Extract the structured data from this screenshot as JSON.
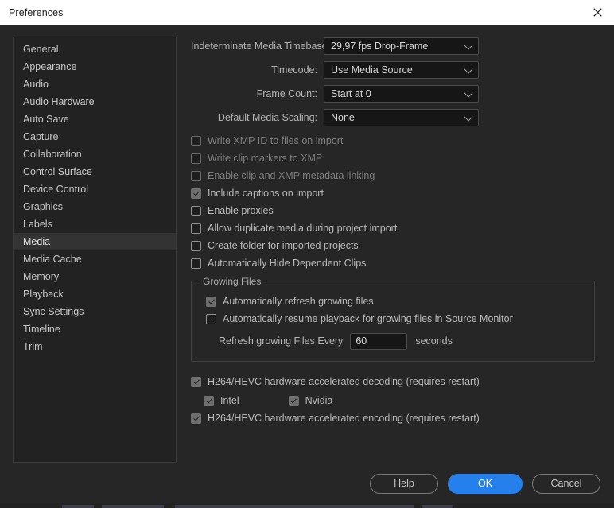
{
  "window": {
    "title": "Preferences",
    "close_icon": "close-icon"
  },
  "sidebar": {
    "items": [
      {
        "label": "General",
        "selected": false
      },
      {
        "label": "Appearance",
        "selected": false
      },
      {
        "label": "Audio",
        "selected": false
      },
      {
        "label": "Audio Hardware",
        "selected": false
      },
      {
        "label": "Auto Save",
        "selected": false
      },
      {
        "label": "Capture",
        "selected": false
      },
      {
        "label": "Collaboration",
        "selected": false
      },
      {
        "label": "Control Surface",
        "selected": false
      },
      {
        "label": "Device Control",
        "selected": false
      },
      {
        "label": "Graphics",
        "selected": false
      },
      {
        "label": "Labels",
        "selected": false
      },
      {
        "label": "Media",
        "selected": true
      },
      {
        "label": "Media Cache",
        "selected": false
      },
      {
        "label": "Memory",
        "selected": false
      },
      {
        "label": "Playback",
        "selected": false
      },
      {
        "label": "Sync Settings",
        "selected": false
      },
      {
        "label": "Timeline",
        "selected": false
      },
      {
        "label": "Trim",
        "selected": false
      }
    ]
  },
  "main": {
    "dropdowns": [
      {
        "label": "Indeterminate Media Timebase:",
        "value": "29,97 fps Drop-Frame",
        "chevron": "chevron-down-icon"
      },
      {
        "label": "Timecode:",
        "value": "Use Media Source",
        "chevron": "chevron-down-icon"
      },
      {
        "label": "Frame Count:",
        "value": "Start at 0",
        "chevron": "chevron-down-icon"
      },
      {
        "label": "Default Media Scaling:",
        "value": "None",
        "chevron": "chevron-down-icon"
      }
    ],
    "checkboxes": [
      {
        "label": "Write XMP ID to files on import",
        "checked": false,
        "disabled": true
      },
      {
        "label": "Write clip markers to XMP",
        "checked": false,
        "disabled": true
      },
      {
        "label": "Enable clip and XMP metadata linking",
        "checked": false,
        "disabled": true
      },
      {
        "label": "Include captions on import",
        "checked": true,
        "disabled": false
      },
      {
        "label": "Enable proxies",
        "checked": false,
        "disabled": false
      },
      {
        "label": "Allow duplicate media during project import",
        "checked": false,
        "disabled": false
      },
      {
        "label": "Create folder for imported projects",
        "checked": false,
        "disabled": false
      },
      {
        "label": "Automatically Hide Dependent Clips",
        "checked": false,
        "disabled": false
      }
    ],
    "growing_files": {
      "legend": "Growing Files",
      "auto_refresh": {
        "label": "Automatically refresh growing files",
        "checked": true
      },
      "auto_resume": {
        "label": "Automatically resume playback for growing files in Source Monitor",
        "checked": false
      },
      "refresh_label": "Refresh growing Files Every",
      "refresh_value": "60",
      "unit_label": "seconds"
    },
    "hardware": {
      "decoding": {
        "label": "H264/HEVC hardware accelerated decoding (requires restart)",
        "checked": true
      },
      "intel": {
        "label": "Intel",
        "checked": true
      },
      "nvidia": {
        "label": "Nvidia",
        "checked": true
      },
      "encoding": {
        "label": "H264/HEVC hardware accelerated encoding (requires restart)",
        "checked": true
      }
    }
  },
  "footer": {
    "help_label": "Help",
    "ok_label": "OK",
    "cancel_label": "Cancel"
  },
  "colors": {
    "accent": "#2680eb",
    "titlebar_bg": "#ffffff",
    "dialog_bg": "#262626",
    "sidebar_bg": "#222222",
    "selected_bg": "#333333"
  }
}
